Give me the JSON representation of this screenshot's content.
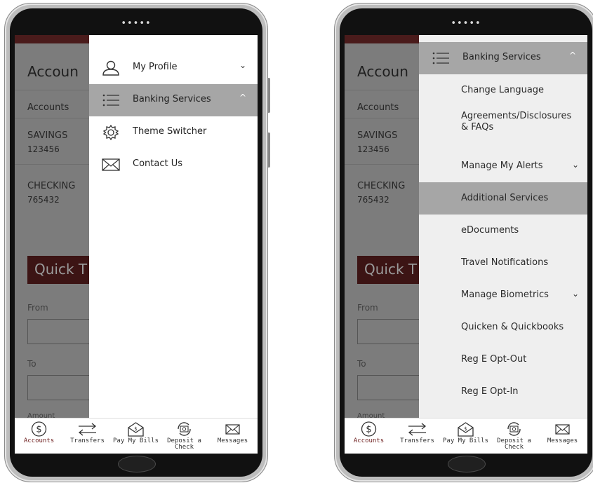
{
  "left_phone": {
    "dots": "•••••",
    "background": {
      "title": "Accoun",
      "tab_label": "Accounts",
      "accounts": [
        {
          "name": "SAVINGS",
          "number": "123456"
        },
        {
          "name": "CHECKING",
          "number": "765432"
        }
      ],
      "quick_title": "Quick T",
      "from_label": "From",
      "to_label": "To",
      "amount_label": "Amount"
    },
    "menu": [
      {
        "label": "My Profile",
        "icon": "user-icon",
        "chevron": "⌄"
      },
      {
        "label": "Banking Services",
        "icon": "list-icon",
        "chevron": "^"
      },
      {
        "label": "Theme Switcher",
        "icon": "gear-icon",
        "chevron": ""
      },
      {
        "label": "Contact Us",
        "icon": "envelope-icon",
        "chevron": ""
      }
    ]
  },
  "right_phone": {
    "dots": "•••••",
    "background": {
      "title": "Accoun",
      "tab_label": "Accounts",
      "accounts": [
        {
          "name": "SAVINGS",
          "number": "123456"
        },
        {
          "name": "CHECKING",
          "number": "765432"
        }
      ],
      "quick_title": "Quick T",
      "from_label": "From",
      "to_label": "To",
      "amount_label": "Amount"
    },
    "header": {
      "label": "Banking Services",
      "icon": "list-icon",
      "chevron": "^"
    },
    "submenu": [
      {
        "label": "Change Language",
        "chevron": ""
      },
      {
        "label": "Agreements/Disclosures & FAQs",
        "chevron": ""
      },
      {
        "label": "Manage My Alerts",
        "chevron": "⌄"
      },
      {
        "label": "Additional Services",
        "chevron": ""
      },
      {
        "label": "eDocuments",
        "chevron": ""
      },
      {
        "label": "Travel Notifications",
        "chevron": ""
      },
      {
        "label": "Manage Biometrics",
        "chevron": "⌄"
      },
      {
        "label": "Quicken & Quickbooks",
        "chevron": ""
      },
      {
        "label": "Reg E Opt-Out",
        "chevron": ""
      },
      {
        "label": "Reg E Opt-In",
        "chevron": ""
      }
    ]
  },
  "tabbar": [
    {
      "label": "Accounts",
      "icon": "dollar-circle-icon"
    },
    {
      "label": "Transfers",
      "icon": "transfer-arrows-icon"
    },
    {
      "label": "Pay My Bills",
      "icon": "bill-envelope-icon"
    },
    {
      "label": "Deposit a Check",
      "icon": "camera-refresh-icon"
    },
    {
      "label": "Messages",
      "icon": "mail-icon"
    }
  ],
  "colors": {
    "accent": "#6b1a1a",
    "selected_row": "#a6a6a6",
    "dim_overlay": "#7c7c7c"
  }
}
